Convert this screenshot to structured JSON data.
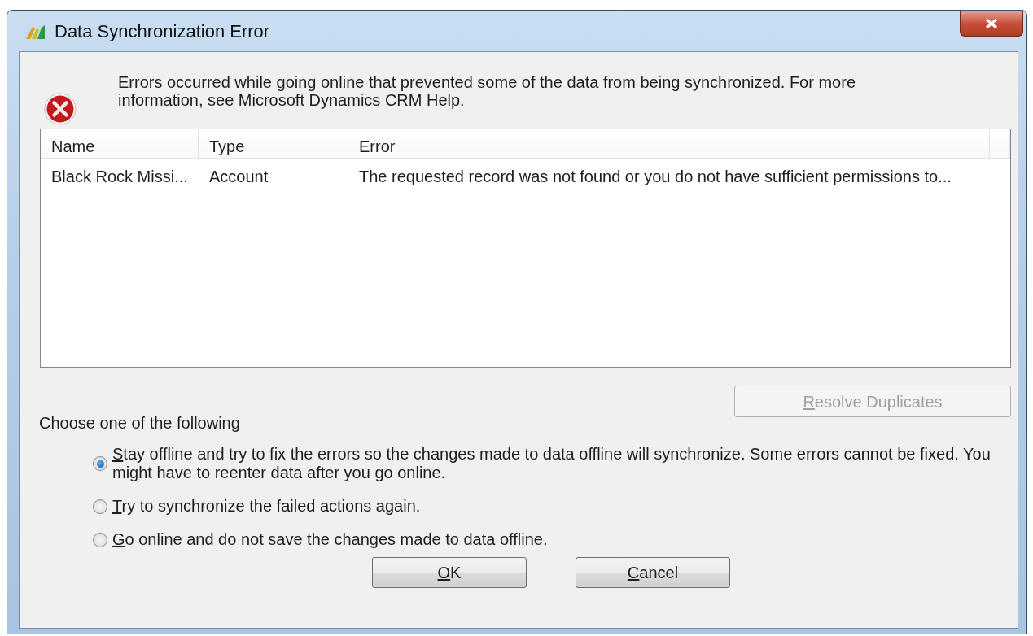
{
  "window": {
    "title": "Data Synchronization Error"
  },
  "message": "Errors occurred while going online that prevented some of the data from being synchronized. For more information, see Microsoft Dynamics CRM Help.",
  "table": {
    "columns": [
      "Name",
      "Type",
      "Error"
    ],
    "rows": [
      {
        "cells": [
          "Black Rock Missi...",
          "Account",
          "The requested record was not found or you do not have sufficient permissions to..."
        ],
        "selected": false
      }
    ]
  },
  "resolve_button": {
    "label": "Resolve Duplicates",
    "disabled": true,
    "underline_first_letter": true
  },
  "choice_prompt": "Choose one of the following",
  "options": [
    {
      "label": "Stay offline and try to fix the errors so the changes made to data offline will synchronize. Some errors cannot be fixed. You might have to reenter data after you go online.",
      "selected": true,
      "underline_first_letter": true
    },
    {
      "label": "Try to synchronize the failed actions again.",
      "selected": false,
      "underline_first_letter": true
    },
    {
      "label": "Go online and do not save the changes made to data offline.",
      "selected": false,
      "underline_first_letter": true
    }
  ],
  "buttons": [
    {
      "label": "OK",
      "disabled": false,
      "underline_first_letter": true
    },
    {
      "label": "Cancel",
      "disabled": false,
      "underline_first_letter": true
    }
  ]
}
